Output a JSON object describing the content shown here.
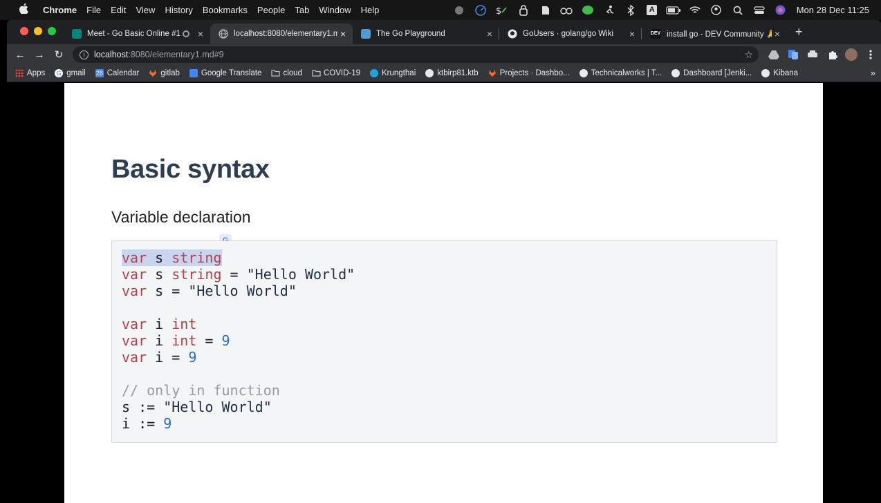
{
  "menubar": {
    "apple": "",
    "app": "Chrome",
    "items": [
      "File",
      "Edit",
      "View",
      "History",
      "Bookmarks",
      "People",
      "Tab",
      "Window",
      "Help"
    ],
    "clock": "Mon 28 Dec  11:25",
    "tray_letter": "A"
  },
  "tabs": [
    {
      "label": "Meet - Go Basic Online #1",
      "close": "×",
      "favicon_color": "#00897b"
    },
    {
      "label": "localhost:8080/elementary1.m",
      "close": "×",
      "favicon_color": "#5f6368"
    },
    {
      "label": "The Go Playground",
      "close": "×",
      "favicon_color": "#4f9bd8"
    },
    {
      "label": "GoUsers · golang/go Wiki",
      "close": "×",
      "favicon_color": "#e8eaed"
    },
    {
      "label": "install go - DEV Community 🙏",
      "close": "×",
      "favicon_color": "#111111",
      "favicon_text": "DEV"
    }
  ],
  "new_tab": "+",
  "toolbar": {
    "back": "←",
    "forward": "→",
    "reload": "↻",
    "url_host": "localhost",
    "url_path": ":8080/elementary1.md#9",
    "star": "☆"
  },
  "bookmarks": [
    {
      "label": "Apps",
      "color": "#ea4335"
    },
    {
      "label": "gmail",
      "color": "#ffffff"
    },
    {
      "label": "Calendar",
      "color": "#4285f4"
    },
    {
      "label": "gitlab",
      "color": "#fc6d26"
    },
    {
      "label": "Google Translate",
      "color": "#4285f4"
    },
    {
      "label": "cloud",
      "color": "#bdc1c6"
    },
    {
      "label": "COVID-19",
      "color": "#bdc1c6"
    },
    {
      "label": "Krungthai",
      "color": "#1ba5e0"
    },
    {
      "label": "ktbirp81.ktb",
      "color": "#e8eaed"
    },
    {
      "label": "Projects · Dashbo...",
      "color": "#fc6d26"
    },
    {
      "label": "Technicalworks | T...",
      "color": "#e8eaed"
    },
    {
      "label": "Dashboard [Jenki...",
      "color": "#e8eaed"
    },
    {
      "label": "Kibana",
      "color": "#e8eaed"
    }
  ],
  "bookmarks_more": "»",
  "page": {
    "title": "Basic syntax",
    "subtitle": "Variable declaration",
    "translate_badge": "G"
  },
  "code": {
    "l1_kw1": "var",
    "l1_id": " s ",
    "l1_kw2": "string",
    "l2_kw1": "var",
    "l2_id": " s ",
    "l2_kw2": "string",
    "l2_op": " = ",
    "l2_str": "\"Hello World\"",
    "l3_kw1": "var",
    "l3_id": " s = ",
    "l3_str": "\"Hello World\"",
    "l5_kw1": "var",
    "l5_id": " i ",
    "l5_kw2": "int",
    "l6_kw1": "var",
    "l6_id": " i ",
    "l6_kw2": "int",
    "l6_op": " = ",
    "l6_num": "9",
    "l7_kw1": "var",
    "l7_id": " i = ",
    "l7_num": "9",
    "l9_cm": "// only in function",
    "l10_id": "s := ",
    "l10_str": "\"Hello World\"",
    "l11_id": "i := ",
    "l11_num": "9"
  }
}
